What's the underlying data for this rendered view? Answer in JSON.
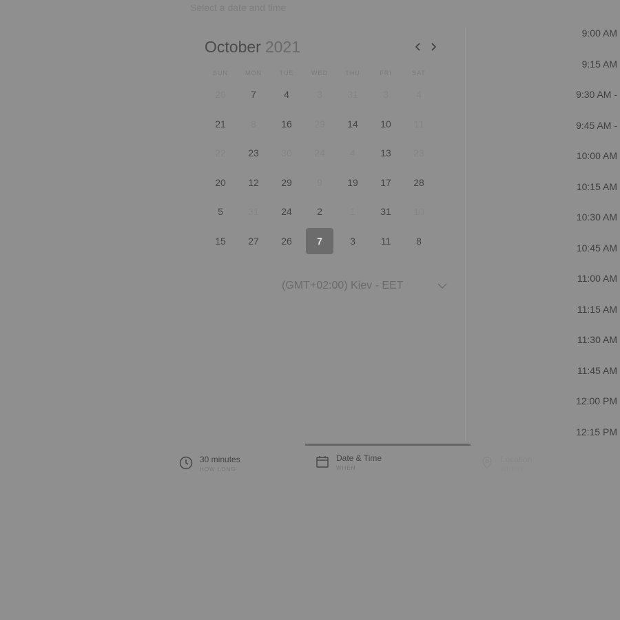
{
  "header": {
    "hint": "Select a date and time"
  },
  "calendar": {
    "month": "October",
    "year": "2021",
    "prev_icon": "chevron-left-icon",
    "next_icon": "chevron-right-icon",
    "weekdays": [
      "SUN",
      "MON",
      "TUE",
      "WED",
      "THU",
      "FRI",
      "SAT"
    ],
    "weeks": [
      [
        {
          "d": "26",
          "muted": true
        },
        {
          "d": "7"
        },
        {
          "d": "4"
        },
        {
          "d": "3",
          "muted": true
        },
        {
          "d": "31",
          "muted": true
        },
        {
          "d": "3",
          "muted": true
        },
        {
          "d": "4",
          "muted": true
        }
      ],
      [
        {
          "d": "21"
        },
        {
          "d": "8",
          "muted": true
        },
        {
          "d": "16"
        },
        {
          "d": "29",
          "muted": true
        },
        {
          "d": "14"
        },
        {
          "d": "10"
        },
        {
          "d": "11",
          "muted": true
        }
      ],
      [
        {
          "d": "22",
          "muted": true
        },
        {
          "d": "23"
        },
        {
          "d": "30",
          "muted": true
        },
        {
          "d": "24",
          "muted": true
        },
        {
          "d": "4",
          "muted": true
        },
        {
          "d": "13"
        },
        {
          "d": "23",
          "muted": true
        }
      ],
      [
        {
          "d": "20"
        },
        {
          "d": "12"
        },
        {
          "d": "29"
        },
        {
          "d": "9",
          "muted": true
        },
        {
          "d": "19"
        },
        {
          "d": "17"
        },
        {
          "d": "28"
        }
      ],
      [
        {
          "d": "5"
        },
        {
          "d": "31",
          "muted": true
        },
        {
          "d": "24"
        },
        {
          "d": "2"
        },
        {
          "d": "1",
          "muted": true
        },
        {
          "d": "31"
        },
        {
          "d": "10",
          "muted": true
        }
      ],
      [
        {
          "d": "15"
        },
        {
          "d": "27"
        },
        {
          "d": "26"
        },
        {
          "d": "7",
          "selected": true
        },
        {
          "d": "3"
        },
        {
          "d": "11"
        },
        {
          "d": "8"
        }
      ]
    ],
    "timezone": "(GMT+02:00) Kiev - EET",
    "timezone_icon": "chevron-down-icon"
  },
  "times": [
    "9:00 AM",
    "9:15 AM",
    "9:30 AM -",
    "9:45 AM -",
    "10:00 AM",
    "10:15 AM",
    "10:30 AM",
    "10:45 AM",
    "11:00 AM",
    "11:15 AM",
    "11:30 AM",
    "11:45 AM",
    "12:00 PM",
    "12:15 PM"
  ],
  "steps": [
    {
      "title": "30 minutes",
      "sub": "HOW LONG",
      "icon": "clock-icon"
    },
    {
      "title": "Date & Time",
      "sub": "WHEN",
      "icon": "calendar-icon"
    },
    {
      "title": "Location",
      "sub": "WHERE",
      "icon": "location-pin-icon"
    }
  ],
  "colors": {
    "overlay": "#8f8f8f",
    "selected": "#6c6c6c"
  }
}
